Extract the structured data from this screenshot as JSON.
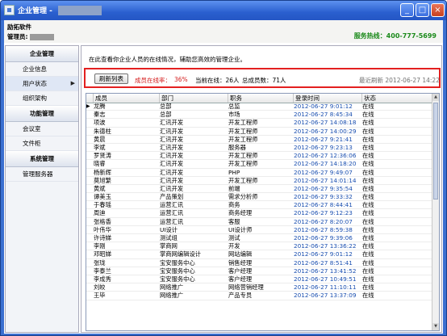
{
  "window": {
    "title": "企业管理 -",
    "buttons": {
      "minimize": "_",
      "maximize": "□",
      "close": "×"
    }
  },
  "header": {
    "company": "励拓软件",
    "admin_label": "管理员:",
    "hotline": "服务热线：400-777-5699"
  },
  "sidebar": {
    "sections": [
      {
        "title": "企业管理",
        "items": [
          {
            "label": "企业信息",
            "active": false
          },
          {
            "label": "用户状态",
            "active": true,
            "arrow": "▶"
          },
          {
            "label": "组织架构",
            "active": false
          }
        ]
      },
      {
        "title": "功能管理",
        "items": [
          {
            "label": "会议室",
            "active": false
          },
          {
            "label": "文件柜",
            "active": false
          }
        ]
      },
      {
        "title": "系统管理",
        "items": [
          {
            "label": "管理服务器",
            "active": false
          }
        ]
      }
    ]
  },
  "main": {
    "intro": "在此查看你企业人员的在线情况，辅助您高效的管理企业。",
    "refresh_label": "刷新列表",
    "online_rate_label": "成员在线率：",
    "online_rate_value": "36%",
    "current_online": "当前在线：26人",
    "total_members": "总成员数：71人",
    "last_refresh": "最近刷新 2012-06-27 14:22",
    "columns": [
      "成员",
      "部门",
      "职务",
      "登录时间",
      "状态"
    ],
    "current_row_marker": "▶",
    "rows": [
      [
        "龙腾",
        "总部",
        "总监",
        "2012-06-27 9:01:12",
        "在线"
      ],
      [
        "秦志",
        "总部",
        "市场",
        "2012-06-27 8:45:34",
        "在线"
      ],
      [
        "项波",
        "汇讯开发",
        "开发工程师",
        "2012-06-27 14:08:18",
        "在线"
      ],
      [
        "朱德柱",
        "汇讯开发",
        "开发工程师",
        "2012-06-27 14:00:29",
        "在线"
      ],
      [
        "黄晨",
        "汇讯开发",
        "开发工程师",
        "2012-06-27 9:21:41",
        "在线"
      ],
      [
        "李斌",
        "汇讯开发",
        "服务器",
        "2012-06-27 9:23:13",
        "在线"
      ],
      [
        "罗贤涛",
        "汇讯开发",
        "开发工程师",
        "2012-06-27 12:36:06",
        "在线"
      ],
      [
        "晓睿",
        "汇讯开发",
        "开发工程师",
        "2012-06-27 14:18:20",
        "在线"
      ],
      [
        "杨新辉",
        "汇讯开发",
        "PHP",
        "2012-06-27 9:49:07",
        "在线"
      ],
      [
        "莫旭繁",
        "汇讯开发",
        "开发工程师",
        "2012-06-27 14:01:14",
        "在线"
      ],
      [
        "黄斌",
        "汇讯开发",
        "前端",
        "2012-06-27 9:35:54",
        "在线"
      ],
      [
        "谭美玉",
        "产品策划",
        "需求分析师",
        "2012-06-27 9:33:32",
        "在线"
      ],
      [
        "于春瑶",
        "运营汇讯",
        "商务",
        "2012-06-27 8:44:41",
        "在线"
      ],
      [
        "周迪",
        "运营汇讯",
        "商务经理",
        "2012-06-27 9:12:23",
        "在线"
      ],
      [
        "张格香",
        "运营汇讯",
        "客服",
        "2012-06-27 8:20:07",
        "在线"
      ],
      [
        "叶伟华",
        "UI设计",
        "UI设计师",
        "2012-06-27 8:59:38",
        "在线"
      ],
      [
        "许诗娣",
        "测试组",
        "测试",
        "2012-06-27 9:39:06",
        "在线"
      ],
      [
        "李刚",
        "掌商网",
        "开发",
        "2012-06-27 13:36:22",
        "在线"
      ],
      [
        "邓昭娣",
        "掌商网编辑设计",
        "网站编辑",
        "2012-06-27 9:01:12",
        "在线"
      ],
      [
        "张珑",
        "宝安服务中心",
        "销售经理",
        "2012-06-27 8:51:41",
        "在线"
      ],
      [
        "李泰兰",
        "宝安服务中心",
        "客户经理",
        "2012-06-27 13:41:52",
        "在线"
      ],
      [
        "李成秀",
        "宝安服务中心",
        "客户经理",
        "2012-06-27 10:49:51",
        "在线"
      ],
      [
        "刘皎",
        "网络推广",
        "网络营销经理",
        "2012-06-27 11:10:11",
        "在线"
      ],
      [
        "王毕",
        "网络推广",
        "产品专员",
        "2012-06-27 13:37:09",
        "在线"
      ]
    ]
  },
  "colors": {
    "title_bar": "#2a5fcf",
    "highlight_border": "#e32020",
    "date_blue": "#1a4fb0",
    "hotline_green": "#1b8a1b"
  }
}
